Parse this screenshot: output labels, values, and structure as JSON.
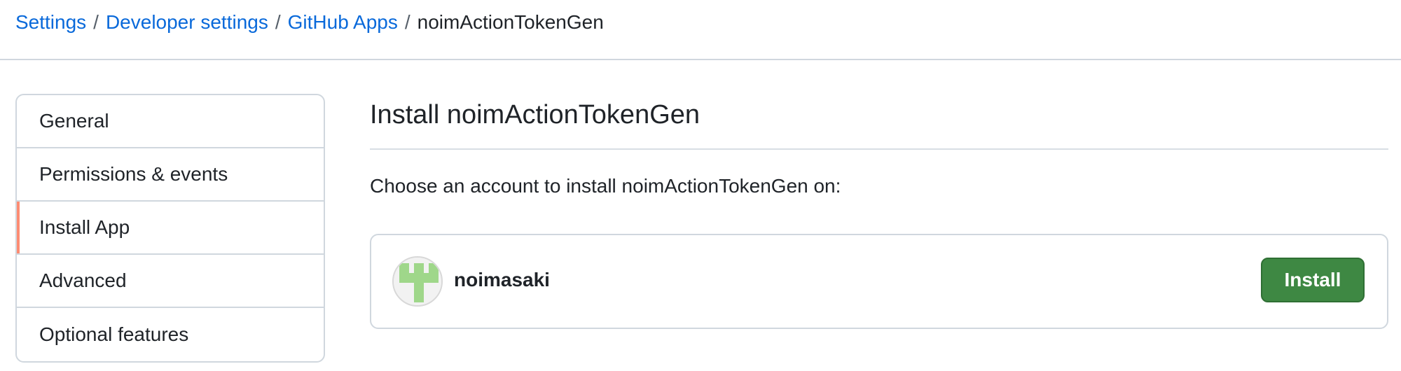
{
  "breadcrumb": {
    "items": [
      {
        "label": "Settings"
      },
      {
        "label": "Developer settings"
      },
      {
        "label": "GitHub Apps"
      }
    ],
    "separator": "/",
    "current": "noimActionTokenGen"
  },
  "sidebar": {
    "items": [
      {
        "label": "General",
        "selected": false
      },
      {
        "label": "Permissions & events",
        "selected": false
      },
      {
        "label": "Install App",
        "selected": true
      },
      {
        "label": "Advanced",
        "selected": false
      },
      {
        "label": "Optional features",
        "selected": false
      }
    ]
  },
  "main": {
    "title": "Install noimActionTokenGen",
    "prompt": "Choose an account to install noimActionTokenGen on:",
    "account": {
      "name": "noimasaki",
      "avatar_icon": "identicon-avatar",
      "install_label": "Install"
    }
  },
  "colors": {
    "link": "#0969da",
    "selected_marker": "#fd8c73",
    "install_button": "#3e8843",
    "avatar_identicon": "#9fd78a"
  }
}
